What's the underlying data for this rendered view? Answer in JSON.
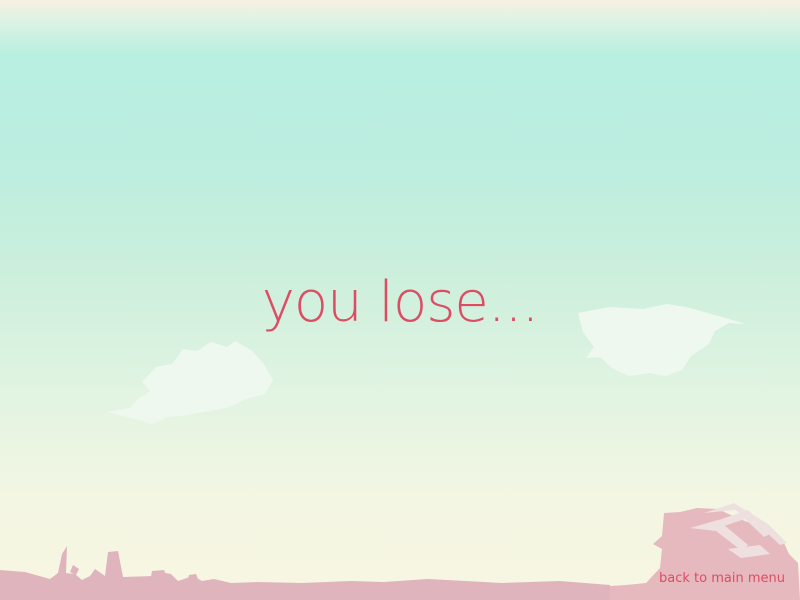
{
  "screen": {
    "title": "you lose...",
    "back_button_label": "back to main menu"
  },
  "colors": {
    "text_accent": "#dc4d64",
    "sky_top": "#f8efe2",
    "sky_main": "#b8efe0",
    "sky_bottom": "#f7f6e2",
    "cloud": "#eef8ef",
    "ground": "#dfb4bd"
  },
  "icons": {
    "left_cloud": "cloud-icon",
    "right_cloud": "cloud-icon",
    "city_silhouette": "city-silhouette-icon",
    "ruins_silhouette": "ruins-silhouette-icon"
  }
}
